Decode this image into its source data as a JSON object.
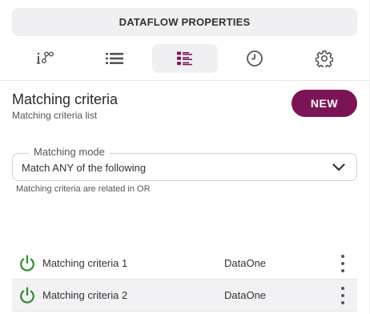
{
  "header": {
    "title": "DATAFLOW PROPERTIES"
  },
  "tabs": [
    {
      "icon": "info-flow-icon",
      "active": false
    },
    {
      "icon": "list-icon",
      "active": false
    },
    {
      "icon": "criteria-list-icon",
      "active": true
    },
    {
      "icon": "clock-icon",
      "active": false
    },
    {
      "icon": "gear-icon",
      "active": false
    }
  ],
  "section": {
    "title": "Matching criteria",
    "subtitle": "Matching criteria list",
    "new_label": "NEW"
  },
  "matching_mode": {
    "label": "Matching mode",
    "value": "Match ANY of the following",
    "helper": "Matching criteria are related in OR"
  },
  "criteria": [
    {
      "name": "Matching criteria 1",
      "source": "DataOne",
      "enabled": true
    },
    {
      "name": "Matching criteria 2",
      "source": "DataOne",
      "enabled": true
    }
  ],
  "colors": {
    "accent": "#7b1457",
    "enabled": "#2e8b2e",
    "tab_active_bg": "#f0eff2"
  }
}
